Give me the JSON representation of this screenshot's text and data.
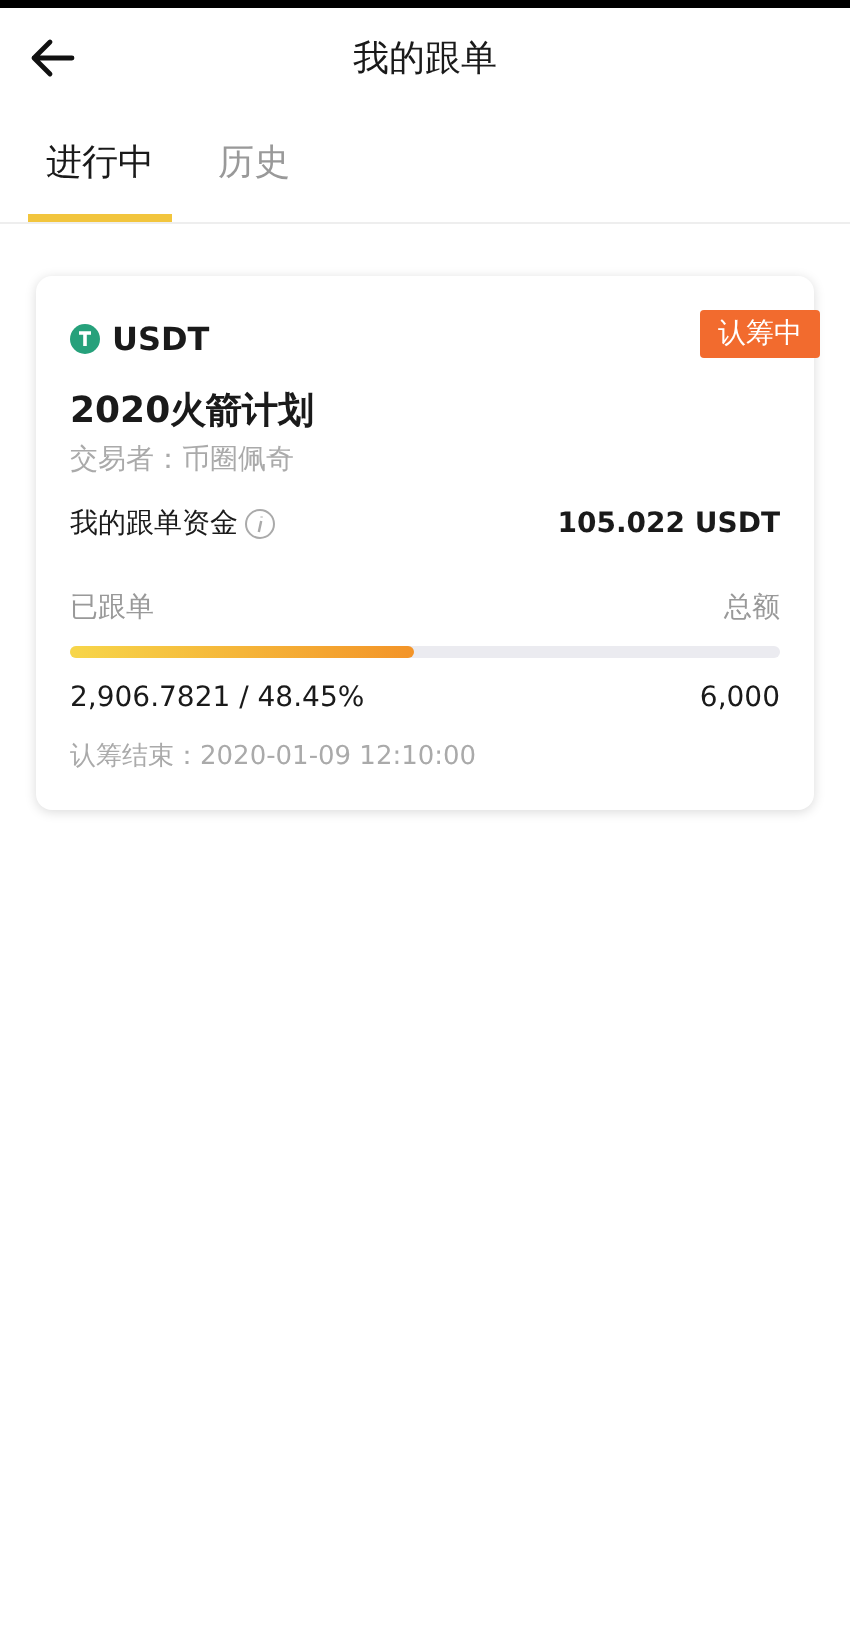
{
  "header": {
    "title": "我的跟单"
  },
  "tabs": [
    {
      "label": "进行中",
      "selected": true
    },
    {
      "label": "历史",
      "selected": false
    }
  ],
  "orders": [
    {
      "coin": "USDT",
      "status": "认筹中",
      "title": "2020火箭计划",
      "trader": "交易者：币圈佩奇",
      "funds_label": "我的跟单资金",
      "funds_value": "105.022 USDT",
      "followed_label": "已跟单",
      "total_label": "总额",
      "level": 0.4845,
      "progress_text": "2,906.7821 / 48.45%",
      "total_value": "6,000",
      "end_text": "认筹结束：2020-01-09 12:10:00"
    }
  ]
}
